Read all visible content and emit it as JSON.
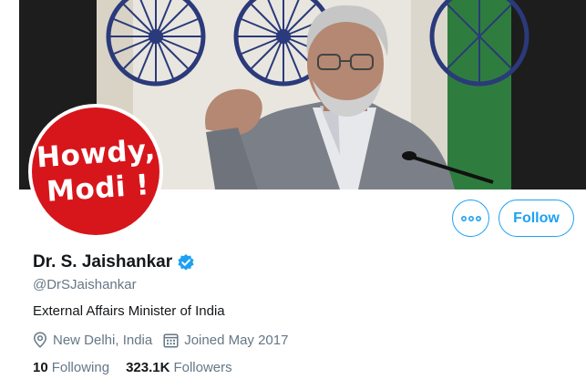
{
  "profile": {
    "avatar_text": {
      "line1": "Howdy,",
      "line2": "Modi !"
    },
    "display_name": "Dr. S. Jaishankar",
    "handle": "@DrSJaishankar",
    "bio": "External Affairs Minister of India",
    "location": "New Delhi, India",
    "joined": "Joined May 2017",
    "following": {
      "count": "10",
      "label": "Following"
    },
    "followers": {
      "count": "323.1K",
      "label": "Followers"
    }
  },
  "actions": {
    "follow_label": "Follow",
    "more_icon": "more-dots-icon"
  },
  "colors": {
    "accent": "#1da1f2",
    "avatar_red": "#d7161c",
    "secondary_text": "#657786"
  }
}
